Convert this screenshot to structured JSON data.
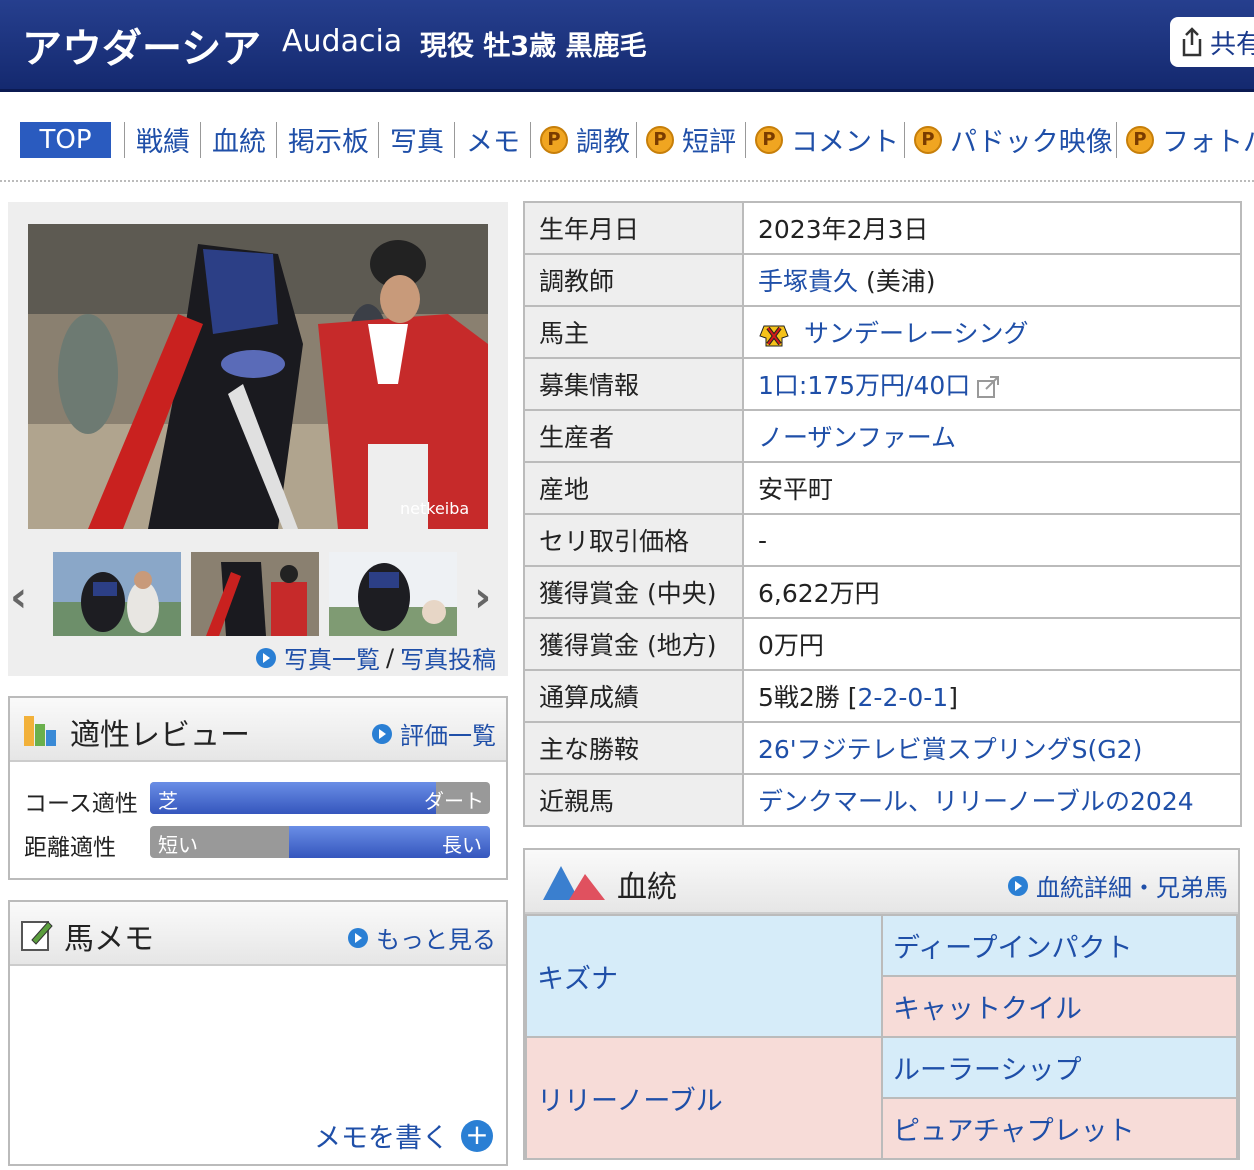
{
  "header": {
    "name": "アウダーシア",
    "english": "Audacia",
    "info": "現役 牡3歳 黒鹿毛",
    "share": "共有"
  },
  "nav": {
    "top": "TOP",
    "items": [
      "戦績",
      "血統",
      "掲示板",
      "写真",
      "メモ",
      "調教",
      "短評",
      "コメント",
      "パドック映像",
      "フォトパ"
    ]
  },
  "photos": {
    "watermark": "netkeiba",
    "list_link": "写真一覧",
    "sep": "/",
    "post_link": "写真投稿"
  },
  "aptitude": {
    "title": "適性レビュー",
    "link": "評価一覧",
    "course_label": "コース適性",
    "turf": "芝",
    "dirt": "ダート",
    "course_value": 0.84,
    "distance_label": "距離適性",
    "short": "短い",
    "long": "長い",
    "distance_value": 0.59
  },
  "memo": {
    "title": "馬メモ",
    "more": "もっと見る",
    "write": "メモを書く"
  },
  "profile": [
    {
      "key": "生年月日",
      "value": "2023年2月3日"
    },
    {
      "key": "調教師",
      "value": "手塚貴久",
      "suffix": " (美浦)"
    },
    {
      "key": "馬主",
      "value": "サンデーレーシング"
    },
    {
      "key": "募集情報",
      "value": "1口:175万円/40口"
    },
    {
      "key": "生産者",
      "value": "ノーザンファーム"
    },
    {
      "key": "産地",
      "value": "安平町"
    },
    {
      "key": "セリ取引価格",
      "value": "-"
    },
    {
      "key": "獲得賞金 (中央)",
      "value": "6,622万円"
    },
    {
      "key": "獲得賞金 (地方)",
      "value": "0万円"
    },
    {
      "key": "通算成績",
      "value": "5戦2勝 [",
      "record": "2-2-0-1",
      "close": "]"
    },
    {
      "key": "主な勝鞍",
      "value": "26'フジテレビ賞スプリングS(G2)"
    },
    {
      "key": "近親馬",
      "value": "デンクマール、リリーノーブルの2024"
    }
  ],
  "pedigree": {
    "title": "血統",
    "link": "血統詳細・兄弟馬",
    "sire": "キズナ",
    "sire_sire": "ディープインパクト",
    "sire_dam": "キャットクイル",
    "dam": "リリーノーブル",
    "dam_sire": "ルーラーシップ",
    "dam_dam": "ピュアチャプレット"
  }
}
